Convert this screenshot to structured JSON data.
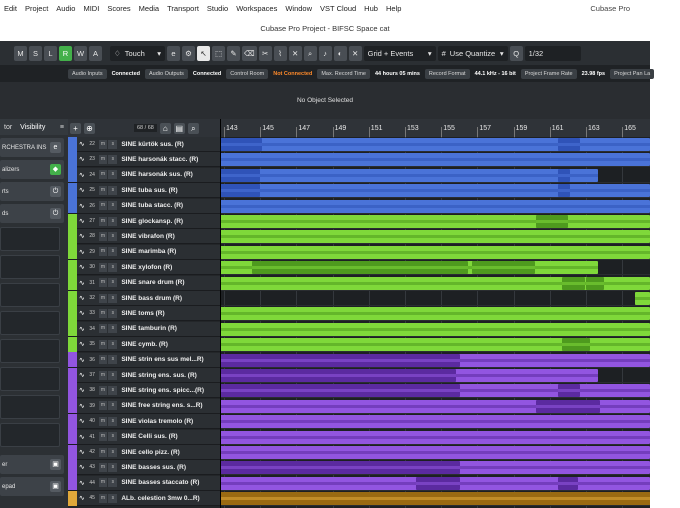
{
  "menu": [
    "Edit",
    "Project",
    "Audio",
    "MIDI",
    "Scores",
    "Media",
    "Transport",
    "Studio",
    "Workspaces",
    "Window",
    "VST Cloud",
    "Hub",
    "Help"
  ],
  "app_name": "Cubase Pro",
  "window_title": "Cubase Pro Project - BIFSC Space cat",
  "toolbar": {
    "ms_buttons": [
      "M",
      "S",
      "L",
      "R",
      "W",
      "A"
    ],
    "automation_mode": "Touch",
    "snap_type": "Grid + Events",
    "quantize": "Use Quantize",
    "quantize_value": "1/32"
  },
  "status": [
    {
      "label": "Audio Inputs",
      "value": "Connected",
      "warn": false
    },
    {
      "label": "Audio Outputs",
      "value": "Connected",
      "warn": false
    },
    {
      "label": "Control Room",
      "value": "Not Connected",
      "warn": true
    },
    {
      "label": "Max. Record Time",
      "value": "44 hours 05 mins",
      "warn": false
    },
    {
      "label": "Record Format",
      "value": "44.1 kHz - 16 bit",
      "warn": false
    },
    {
      "label": "Project Frame Rate",
      "value": "23.98 fps",
      "warn": false
    },
    {
      "label": "Project Pan La",
      "value": "",
      "warn": false
    }
  ],
  "info_line": "No Object Selected",
  "inspector": {
    "tabs": [
      "tor",
      "Visibility"
    ],
    "rows": [
      "RCHESTRA INS",
      "alizers",
      "rts",
      "ds"
    ],
    "bottom_rows": [
      "er",
      "epad"
    ]
  },
  "track_header": {
    "count": "68 / 68"
  },
  "ruler": [
    "143",
    "145",
    "147",
    "149",
    "151",
    "153",
    "155",
    "157",
    "159",
    "161",
    "163",
    "165"
  ],
  "colors": {
    "blue": "#4a73d8",
    "green": "#7fd83a",
    "purple": "#9255e0",
    "orange": "#e0a83a"
  },
  "tracks": [
    {
      "num": "22",
      "name": "SINE kürtök sus.  (R)",
      "color": "blue"
    },
    {
      "num": "23",
      "name": "SINE harsonák stacc.  (R)",
      "color": "blue"
    },
    {
      "num": "24",
      "name": "SINE harsonák sus.  (R)",
      "color": "blue"
    },
    {
      "num": "25",
      "name": "SINE tuba sus.  (R)",
      "color": "blue"
    },
    {
      "num": "26",
      "name": "SINE tuba stacc.  (R)",
      "color": "blue"
    },
    {
      "num": "27",
      "name": "SINE glockansp.  (R)",
      "color": "green"
    },
    {
      "num": "28",
      "name": "SINE vibrafon  (R)",
      "color": "green"
    },
    {
      "num": "29",
      "name": "SINE marimba  (R)",
      "color": "green"
    },
    {
      "num": "30",
      "name": "SINE xylofon  (R)",
      "color": "green"
    },
    {
      "num": "31",
      "name": "SINE snare drum  (R)",
      "color": "green"
    },
    {
      "num": "32",
      "name": "SINE bass drum  (R)",
      "color": "green"
    },
    {
      "num": "33",
      "name": "SINE toms  (R)",
      "color": "green"
    },
    {
      "num": "34",
      "name": "SINE tamburin  (R)",
      "color": "green"
    },
    {
      "num": "35",
      "name": "SINE cymb.  (R)",
      "color": "green"
    },
    {
      "num": "36",
      "name": "SINE strin ens sus mel...R)",
      "color": "purple"
    },
    {
      "num": "37",
      "name": "SINE string ens. sus.  (R)",
      "color": "purple"
    },
    {
      "num": "38",
      "name": "SINE string ens. spicc...(R)",
      "color": "purple"
    },
    {
      "num": "39",
      "name": "SINE free string ens. s...R)",
      "color": "purple"
    },
    {
      "num": "40",
      "name": "SINE violas tremolo  (R)",
      "color": "purple"
    },
    {
      "num": "41",
      "name": "SINE Celli sus.  (R)",
      "color": "purple"
    },
    {
      "num": "42",
      "name": "SINE cello pizz.  (R)",
      "color": "purple"
    },
    {
      "num": "43",
      "name": "SINE basses sus.  (R)",
      "color": "purple"
    },
    {
      "num": "44",
      "name": "SINE basses staccato  (R)",
      "color": "purple"
    },
    {
      "num": "45",
      "name": "ALb. celestion 3mw 0...R)",
      "color": "orange"
    }
  ]
}
